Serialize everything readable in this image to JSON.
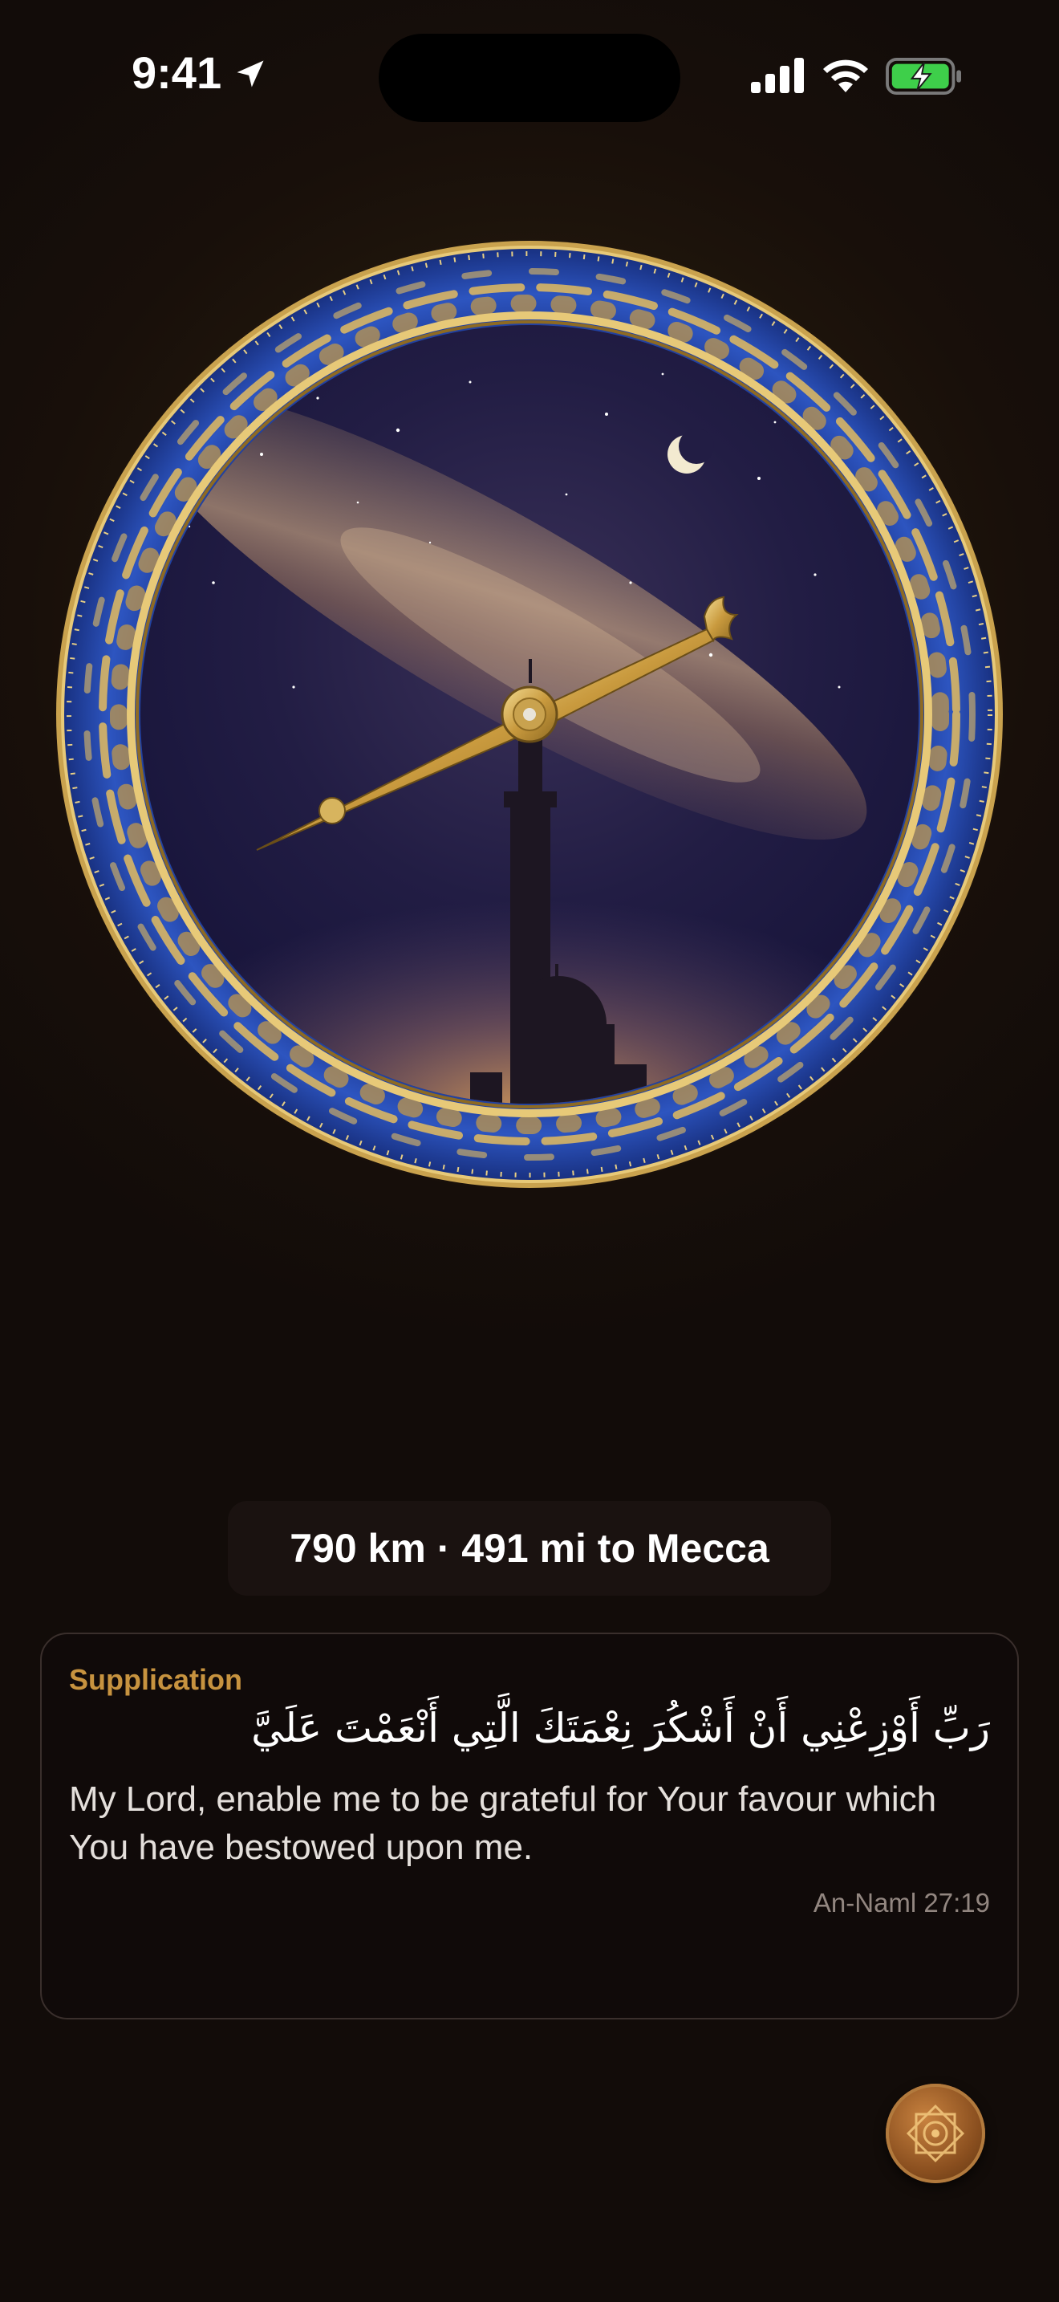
{
  "status_bar": {
    "time": "9:41",
    "icons": [
      "location-arrow-icon",
      "cellular-signal-icon",
      "wifi-icon",
      "battery-charging-icon"
    ]
  },
  "compass": {
    "icons": [
      "crescent-moon-icon",
      "mosque-silhouette-icon",
      "qibla-needle-icon"
    ],
    "colors": {
      "bezel_blue": "#2a4fb0",
      "gold": "#d6b25a",
      "sky_dark": "#1b1a3a"
    }
  },
  "distance": {
    "text": "790 km · 491 mi to Mecca"
  },
  "supplication": {
    "title": "Supplication",
    "arabic": "رَبِّ أَوْزِعْنِي أَنْ أَشْكُرَ نِعْمَتَكَ الَّتِي أَنْعَمْتَ عَلَيَّ",
    "translation": "My Lord, enable me to be grateful for Your favour which You have bestowed upon me.",
    "reference": "An-Naml 27:19"
  },
  "fab": {
    "icon": "eight-point-star-icon"
  },
  "colors": {
    "accent": "#c7933f",
    "background": "#120c09"
  }
}
